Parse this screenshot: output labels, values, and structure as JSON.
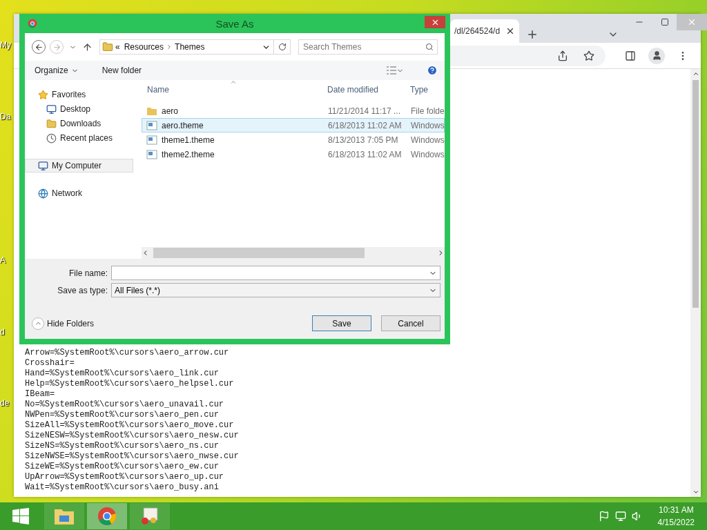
{
  "desktop": {
    "icon_labels": [
      "My",
      "Da",
      "A",
      "d",
      "de"
    ]
  },
  "browser": {
    "tab": {
      "title": "/dl/264524/d"
    },
    "lines": [
      "Arrow=%SystemRoot%\\cursors\\aero_arrow.cur",
      "Crosshair=",
      "Hand=%SystemRoot%\\cursors\\aero_link.cur",
      "Help=%SystemRoot%\\cursors\\aero_helpsel.cur",
      "IBeam=",
      "No=%SystemRoot%\\cursors\\aero_unavail.cur",
      "NWPen=%SystemRoot%\\cursors\\aero_pen.cur",
      "SizeAll=%SystemRoot%\\cursors\\aero_move.cur",
      "SizeNESW=%SystemRoot%\\cursors\\aero_nesw.cur",
      "SizeNS=%SystemRoot%\\cursors\\aero_ns.cur",
      "SizeNWSE=%SystemRoot%\\cursors\\aero_nwse.cur",
      "SizeWE=%SystemRoot%\\cursors\\aero_ew.cur",
      "UpArrow=%SystemRoot%\\cursors\\aero_up.cur",
      "Wait=%SystemRoot%\\cursors\\aero_busy.ani"
    ]
  },
  "dialog": {
    "title": "Save As",
    "address": {
      "overflow": "«",
      "path": [
        "Resources",
        "Themes"
      ]
    },
    "search": {
      "placeholder": "Search Themes"
    },
    "toolbar": {
      "organize": "Organize",
      "new_folder": "New folder"
    },
    "nav_items": [
      {
        "label": "Favorites",
        "kind": "favorites",
        "selected": false,
        "children": [
          {
            "label": "Desktop",
            "kind": "desktop",
            "selected": false
          },
          {
            "label": "Downloads",
            "kind": "downloads",
            "selected": false
          },
          {
            "label": "Recent places",
            "kind": "recent",
            "selected": false
          }
        ]
      },
      {
        "label": "My Computer",
        "kind": "computer",
        "selected": true
      },
      {
        "label": "Network",
        "kind": "network",
        "selected": false
      }
    ],
    "columns": [
      "Name",
      "Date modified",
      "Type"
    ],
    "files": [
      {
        "name": "aero",
        "date": "11/21/2014 11:17 ...",
        "type": "File folde",
        "kind": "folder",
        "selected": false
      },
      {
        "name": "aero.theme",
        "date": "6/18/2013 11:02 AM",
        "type": "Windows",
        "kind": "theme",
        "selected": true
      },
      {
        "name": "theme1.theme",
        "date": "8/13/2013 7:05 PM",
        "type": "Windows",
        "kind": "theme",
        "selected": false
      },
      {
        "name": "theme2.theme",
        "date": "6/18/2013 11:02 AM",
        "type": "Windows",
        "kind": "theme",
        "selected": false
      }
    ],
    "file_name": {
      "label": "File name:"
    },
    "save_type": {
      "label": "Save as type:",
      "value": "All Files (*.*)"
    },
    "hide_folders": "Hide Folders",
    "buttons": [
      "Save",
      "Cancel"
    ]
  },
  "taskbar": {
    "apps": [
      {
        "kind": "explorer",
        "selected": false
      },
      {
        "kind": "chrome",
        "selected": true
      },
      {
        "kind": "certificate",
        "selected": false
      }
    ],
    "time": "10:31 AM",
    "date": "4/15/2022"
  }
}
